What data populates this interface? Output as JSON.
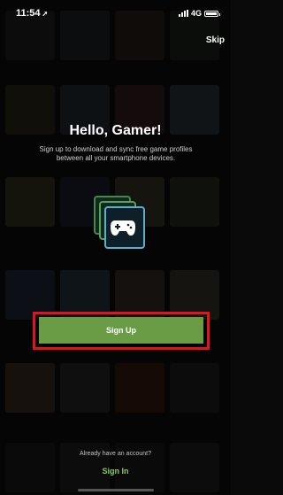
{
  "status_bar": {
    "time": "11:54",
    "location_glyph": "➚",
    "network": "4G"
  },
  "header": {
    "skip_label": "Skip"
  },
  "hero": {
    "title": "Hello, Gamer!",
    "subtitle": "Sign up to download and sync free game profiles between all your smartphone devices."
  },
  "actions": {
    "signup_label": "Sign Up",
    "already_text": "Already have an account?",
    "signin_label": "Sign In"
  },
  "colors": {
    "accent_green": "#6a9b45",
    "link_green": "#8cc95e",
    "highlight_red": "#e0141c"
  },
  "icons": [
    "location-arrow-icon",
    "signal-icon",
    "battery-icon",
    "gamepad-stack-icon"
  ]
}
